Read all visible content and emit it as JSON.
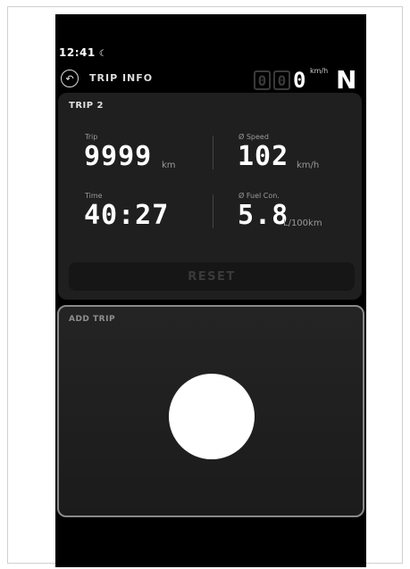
{
  "status_bar": {
    "time": "12:41",
    "moon_icon": "☾"
  },
  "header": {
    "back_icon": "↶",
    "title": "TRIP INFO"
  },
  "speedometer": {
    "dim_digits": [
      "0",
      "0"
    ],
    "digit": "0",
    "unit": "km/h",
    "gear": "N"
  },
  "trip": {
    "label": "TRIP 2",
    "distance": {
      "label": "Trip",
      "value": "9999",
      "unit": "km"
    },
    "avg_speed": {
      "label": "Ø Speed",
      "value": "102",
      "unit": "km/h"
    },
    "time": {
      "label": "Time",
      "value": "40:27"
    },
    "fuel": {
      "label": "Ø Fuel Con.",
      "value": "5.8",
      "unit": "L/100km"
    },
    "reset_label": "RESET"
  },
  "add_trip": {
    "label": "ADD TRIP"
  }
}
